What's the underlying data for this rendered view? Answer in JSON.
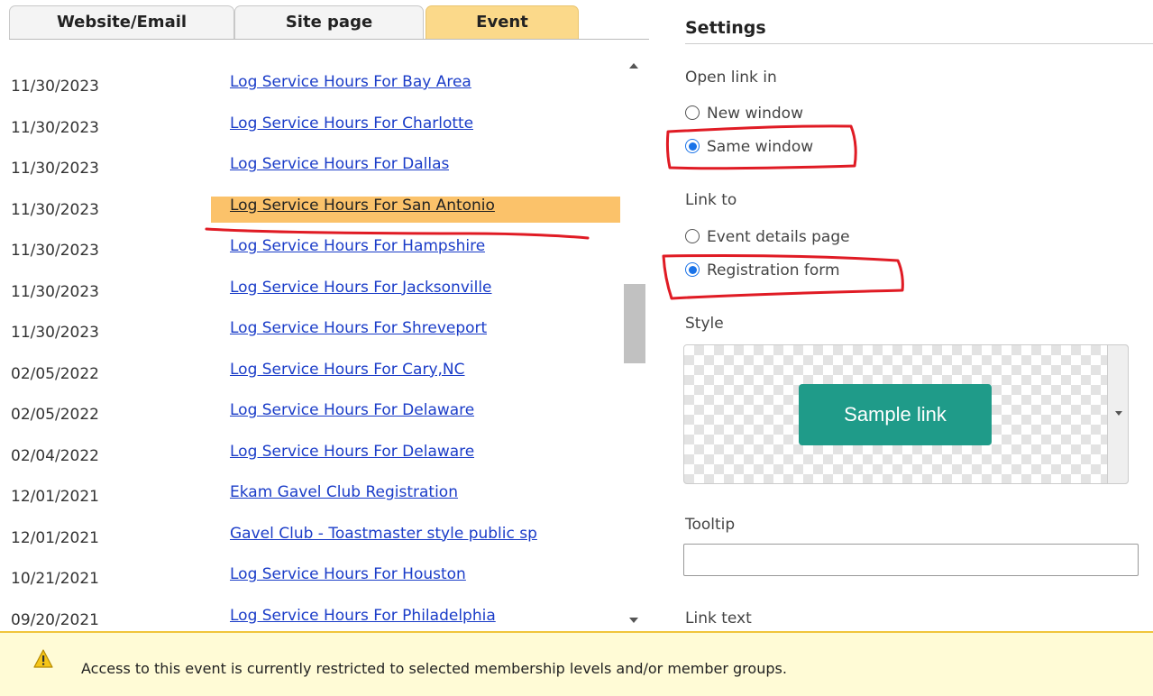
{
  "tabs": [
    {
      "label": "Website/Email",
      "active": false
    },
    {
      "label": "Site page",
      "active": false
    },
    {
      "label": "Event",
      "active": true
    }
  ],
  "events": [
    {
      "date": "11/30/2023",
      "title": "Log Service Hours For Bay Area"
    },
    {
      "date": "11/30/2023",
      "title": "Log Service Hours For Charlotte"
    },
    {
      "date": "11/30/2023",
      "title": "Log Service Hours For Dallas"
    },
    {
      "date": "11/30/2023",
      "title": "Log Service Hours For San Antonio",
      "selected": true
    },
    {
      "date": "11/30/2023",
      "title": "Log Service Hours For Hampshire"
    },
    {
      "date": "11/30/2023",
      "title": "Log Service Hours For Jacksonville"
    },
    {
      "date": "11/30/2023",
      "title": "Log Service Hours For Shreveport"
    },
    {
      "date": "02/05/2022",
      "title": "Log Service Hours For Cary,NC"
    },
    {
      "date": "02/05/2022",
      "title": "Log Service Hours For Delaware"
    },
    {
      "date": "02/04/2022",
      "title": "Log Service Hours For Delaware"
    },
    {
      "date": "12/01/2021",
      "title": "Ekam Gavel Club Registration"
    },
    {
      "date": "12/01/2021",
      "title": "Gavel Club - Toastmaster style public sp"
    },
    {
      "date": "10/21/2021",
      "title": "Log Service Hours For Houston"
    },
    {
      "date": "09/20/2021",
      "title": "Log Service Hours For Philadelphia"
    }
  ],
  "settings": {
    "title": "Settings",
    "open_link_in": {
      "label": "Open link in",
      "options": [
        {
          "label": "New window",
          "checked": false
        },
        {
          "label": "Same window",
          "checked": true
        }
      ]
    },
    "link_to": {
      "label": "Link to",
      "options": [
        {
          "label": "Event details page",
          "checked": false
        },
        {
          "label": "Registration form",
          "checked": true
        }
      ]
    },
    "style": {
      "label": "Style",
      "sample_text": "Sample link",
      "button_color": "#1f9b89"
    },
    "tooltip": {
      "label": "Tooltip",
      "value": ""
    },
    "link_text": {
      "label": "Link text"
    }
  },
  "notice": {
    "icon": "warning-icon",
    "message": "Access to this event is currently restricted to selected membership levels and/or member groups."
  },
  "colors": {
    "active_tab": "#fbd98a",
    "selected_row": "#fbc26a",
    "link": "#1a3cc8",
    "annotation": "#e01b24",
    "notice_bg": "#fffbd6"
  }
}
